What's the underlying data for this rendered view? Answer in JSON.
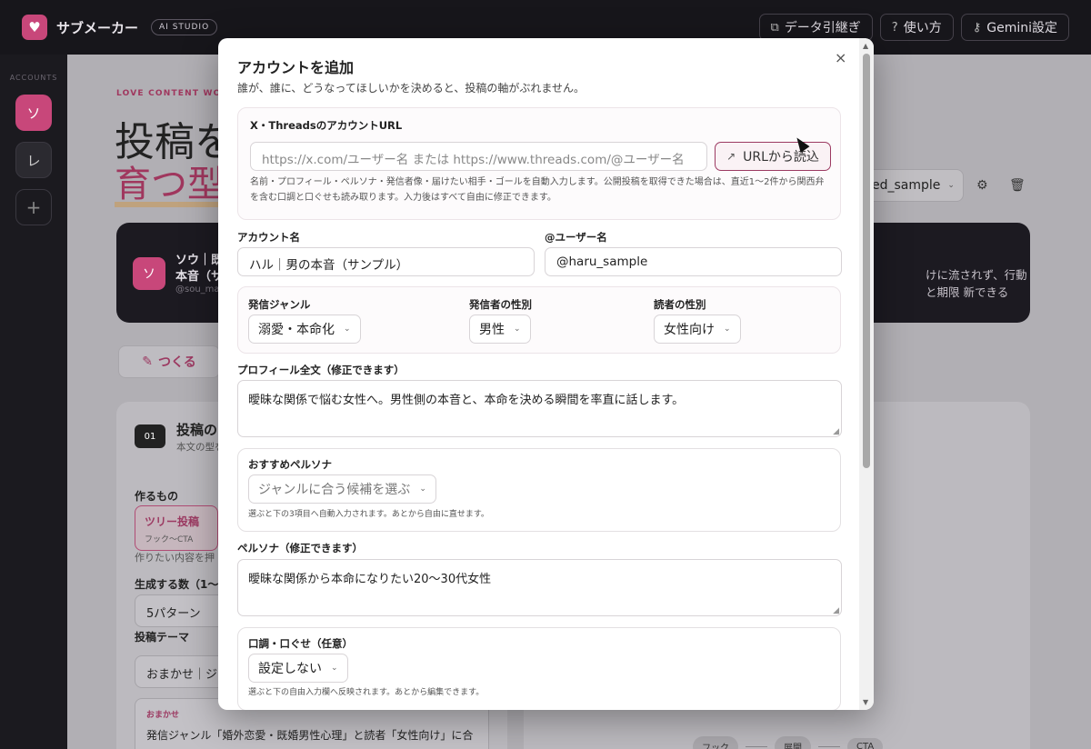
{
  "app": {
    "name": "サブメーカー",
    "badge": "AI STUDIO",
    "actions": [
      {
        "label": "データ引継ぎ",
        "icon": "copy-icon"
      },
      {
        "label": "使い方",
        "icon": "help-icon"
      },
      {
        "label": "Gemini設定",
        "icon": "key-icon"
      }
    ]
  },
  "sidebar": {
    "label": "ACCOUNTS",
    "accounts": [
      {
        "initial": "ソ"
      },
      {
        "initial": "レ"
      }
    ],
    "add": "+"
  },
  "main": {
    "kicker": "LOVE CONTENT WO",
    "heading_line1": "投稿を",
    "heading_line2": "育つ型",
    "account_select": "ed_sample",
    "profile": {
      "initial": "ソ",
      "name_line1": "ソウ｜既",
      "name_line2": "本音（サ",
      "handle": "@sou_ma",
      "right_text": "けに流されず、行動と期限 新できる"
    },
    "tab_make": "つくる",
    "step": {
      "number": "01",
      "title": "投稿の",
      "subtitle": "本文の型を"
    },
    "make_label": "作るもの",
    "tree_title": "ツリー投稿",
    "tree_sub": "フック〜CTA",
    "make_hint": "作りたい内容を押",
    "count_label": "生成する数（1〜1",
    "count_value": "5パターン",
    "theme_label": "投稿テーマ",
    "theme_value": "おまかせ｜ジ",
    "note_tag": "おまかせ",
    "note_text": "発信ジャンル「婚外恋愛・既婚男性心理」と読者「女性向け」に合",
    "flow": [
      "フック",
      "展開",
      "CTA"
    ]
  },
  "modal": {
    "title": "アカウントを追加",
    "subtitle": "誰が、誰に、どうなってほしいかを決めると、投稿の軸がぶれません。",
    "close": "×",
    "url_section": {
      "label": "X・ThreadsのアカウントURL",
      "placeholder": "https://x.com/ユーザー名 または https://www.threads.com/@ユーザー名",
      "button": "URLから読込",
      "hint": "名前・プロフィール・ペルソナ・発信者像・届けたい相手・ゴールを自動入力します。公開投稿を取得できた場合は、直近1〜2件から関西弁を含む口調と口ぐせも読み取ります。入力後はすべて自由に修正できます。"
    },
    "account_name": {
      "label": "アカウント名",
      "value": "ハル｜男の本音（サンプル）"
    },
    "username": {
      "label": "@ユーザー名",
      "value": "@haru_sample"
    },
    "genre": {
      "label": "発信ジャンル",
      "value": "溺愛・本命化"
    },
    "sender_gender": {
      "label": "発信者の性別",
      "value": "男性"
    },
    "reader_gender": {
      "label": "読者の性別",
      "value": "女性向け"
    },
    "profile": {
      "label": "プロフィール全文（修正できます）",
      "value": "曖昧な関係で悩む女性へ。男性側の本音と、本命を決める瞬間を率直に話します。"
    },
    "persona_pick": {
      "label": "おすすめペルソナ",
      "value": "ジャンルに合う候補を選ぶ",
      "hint": "選ぶと下の3項目へ自動入力されます。あとから自由に直せます。"
    },
    "persona": {
      "label": "ペルソナ（修正できます）",
      "value": "曖昧な関係から本命になりたい20〜30代女性"
    },
    "tone": {
      "label": "口調・口ぐせ（任意）",
      "value": "設定しない",
      "hint": "選ぶと下の自由入力欄へ反映されます。あとから編集できます。"
    }
  }
}
